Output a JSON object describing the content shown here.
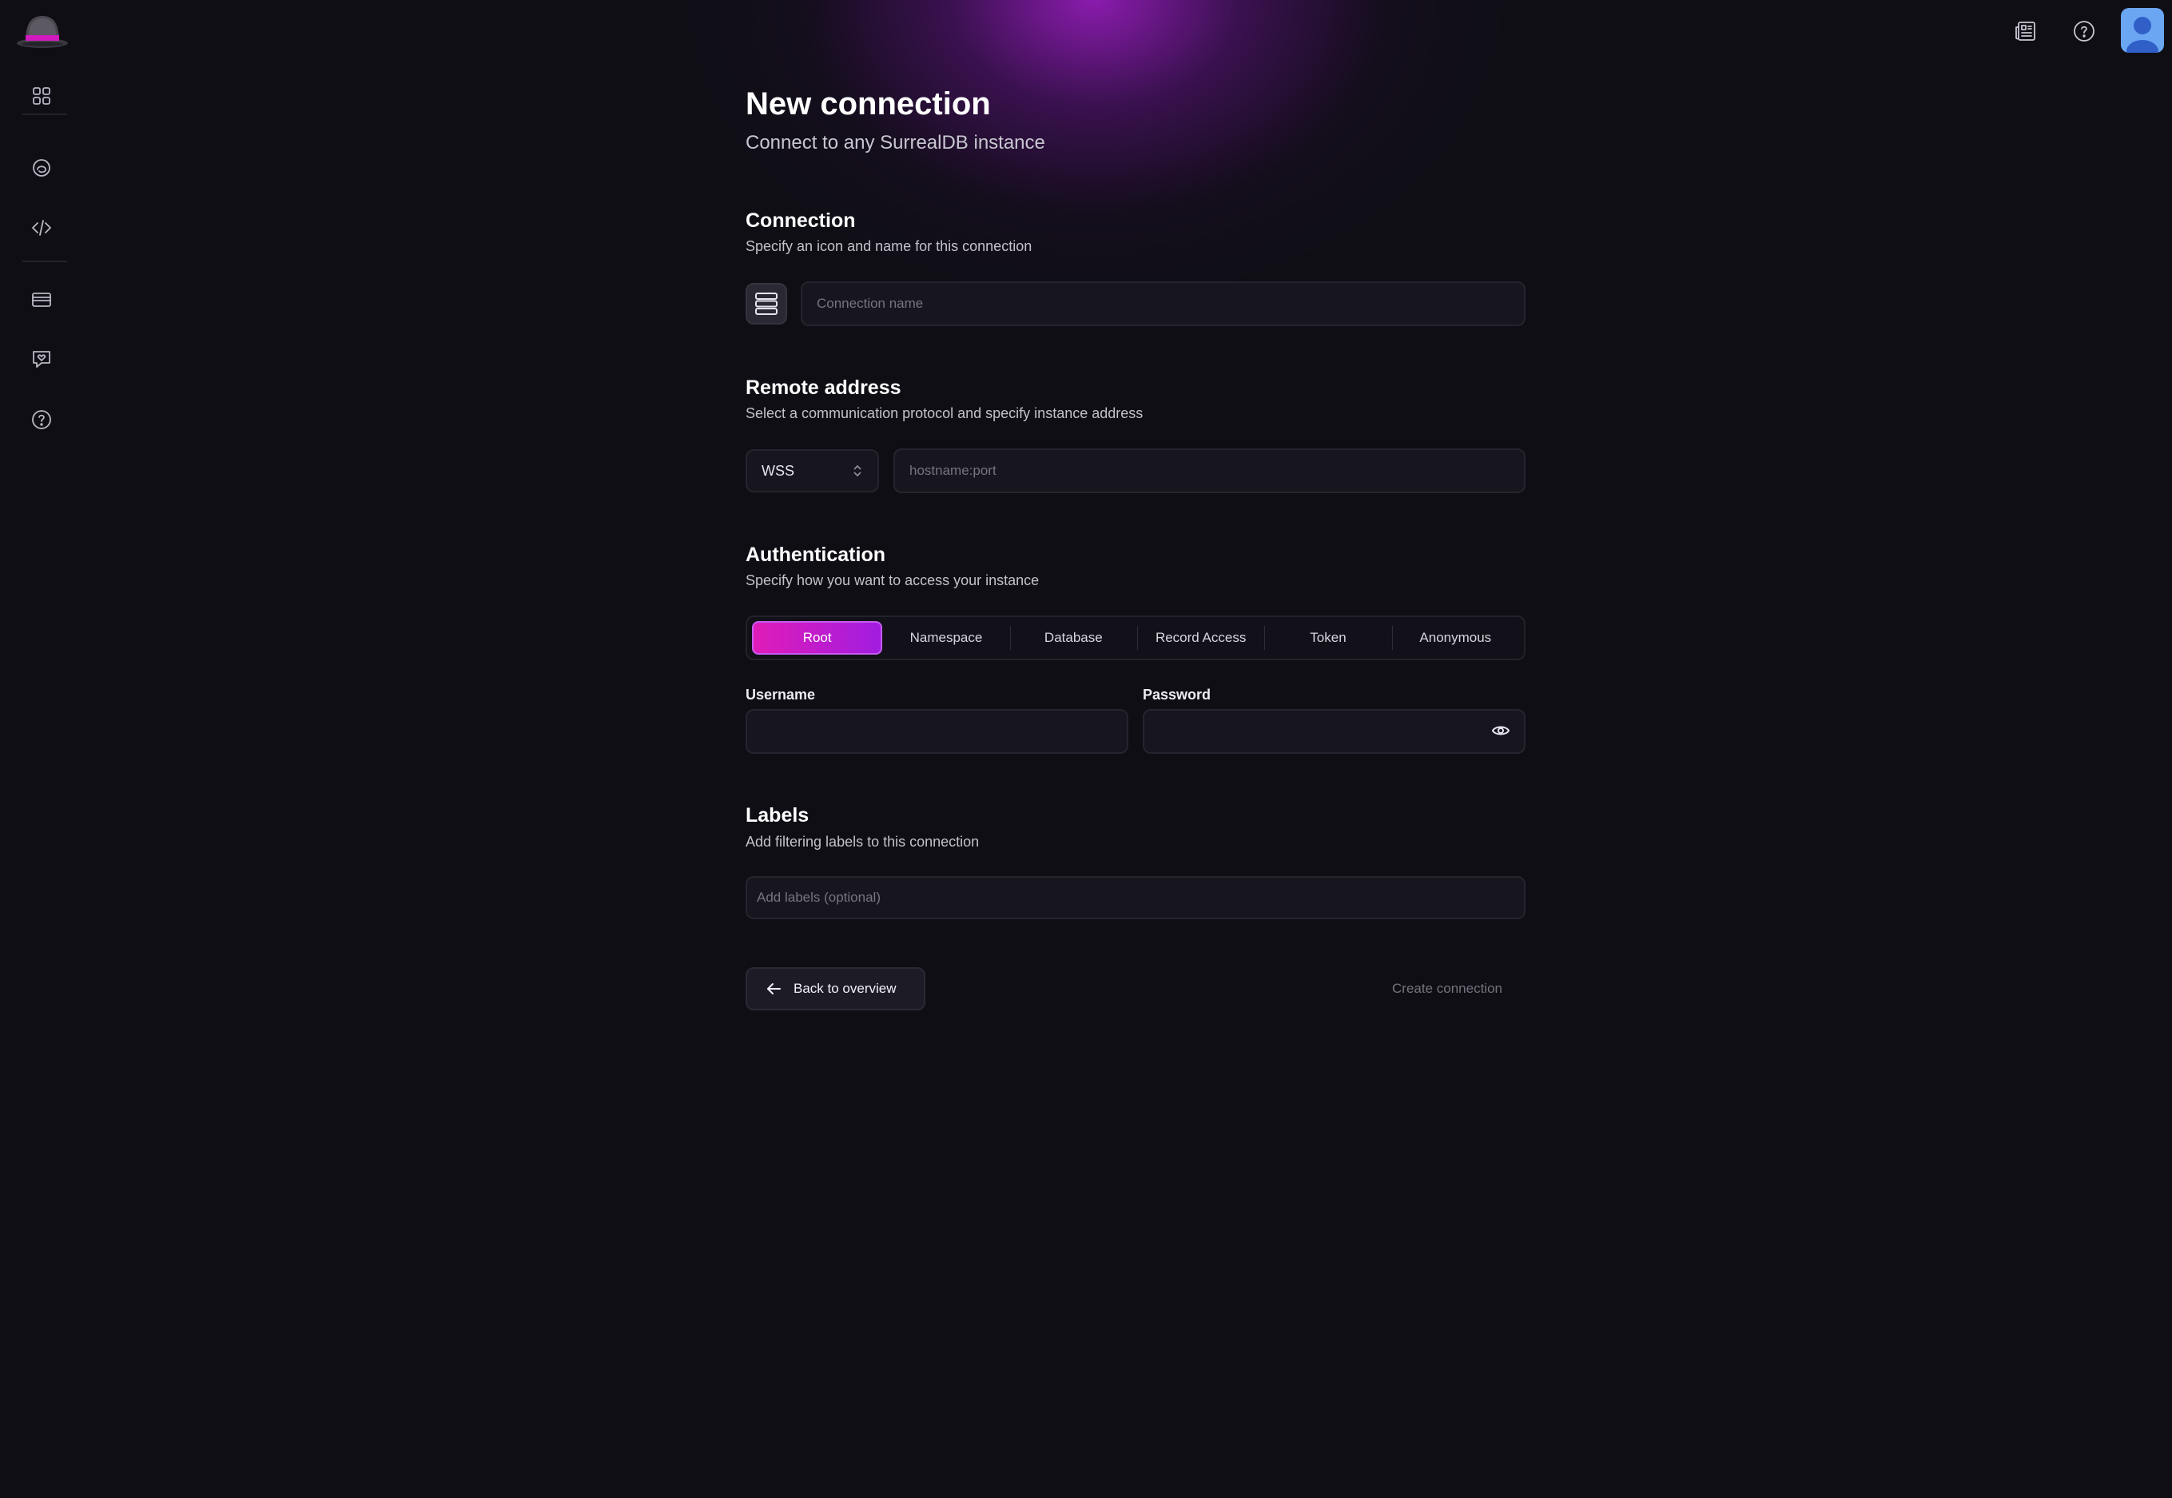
{
  "header": {
    "news_icon": "newspaper-icon",
    "help_icon": "help-icon",
    "avatar_icon": "user-avatar"
  },
  "sidebar": {
    "items": [
      {
        "name": "overview",
        "icon": "grid-icon"
      },
      {
        "name": "cloud",
        "icon": "cloud-icon"
      },
      {
        "name": "query",
        "icon": "code-icon"
      },
      {
        "name": "billing",
        "icon": "card-icon"
      },
      {
        "name": "feedback",
        "icon": "chat-heart-icon"
      },
      {
        "name": "help",
        "icon": "help-icon"
      }
    ]
  },
  "page": {
    "title": "New connection",
    "subtitle": "Connect to any SurrealDB instance"
  },
  "connection": {
    "title": "Connection",
    "subtitle": "Specify an icon and name for this connection",
    "name_placeholder": "Connection name",
    "name_value": ""
  },
  "remote": {
    "title": "Remote address",
    "subtitle": "Select a communication protocol and specify instance address",
    "protocol": "WSS",
    "address_placeholder": "hostname:port",
    "address_value": ""
  },
  "auth": {
    "title": "Authentication",
    "subtitle": "Specify how you want to access your instance",
    "tabs": [
      "Root",
      "Namespace",
      "Database",
      "Record Access",
      "Token",
      "Anonymous"
    ],
    "active_tab": "Root",
    "username_label": "Username",
    "password_label": "Password",
    "username_value": "",
    "password_value": ""
  },
  "labels": {
    "title": "Labels",
    "subtitle": "Add filtering labels to this connection",
    "placeholder": "Add labels (optional)"
  },
  "actions": {
    "back_label": "Back to overview",
    "create_label": "Create connection"
  },
  "colors": {
    "background": "#0f0e15",
    "accent_start": "#e01cb8",
    "accent_end": "#a11de0",
    "glow": "#a01ec8"
  }
}
